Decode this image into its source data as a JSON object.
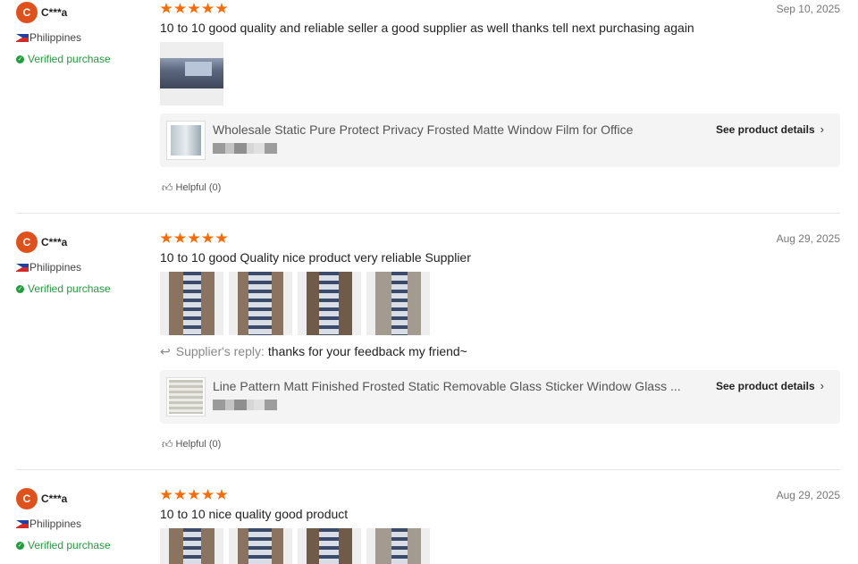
{
  "colors": {
    "accent_star": "#ff6a00",
    "avatar_bg": "#e0501b",
    "verified_green": "#1f9d3a"
  },
  "reviews": [
    {
      "avatar_initial": "C",
      "username": "C***a",
      "country": "Philippines",
      "flag_icon": "philippines-flag-icon",
      "verified": "Verified purchase",
      "rating": 5,
      "date": "Sep 10, 2025",
      "text": "10 to 10 good quality and reliable seller a good supplier as well thanks tell next purchasing again",
      "product_title": "Wholesale Static Pure Protect Privacy Frosted Matte Window Film for Office",
      "see_details": "See product details",
      "helpful": "Helpful (0)"
    },
    {
      "avatar_initial": "C",
      "username": "C***a",
      "country": "Philippines",
      "flag_icon": "philippines-flag-icon",
      "verified": "Verified purchase",
      "rating": 5,
      "date": "Aug 29, 2025",
      "text": "10 to 10 good Quality nice product very reliable Supplier",
      "reply_label": "Supplier's reply:",
      "reply_text": "thanks for your feedback my friend~",
      "product_title": "Line Pattern Matt Finished Frosted Static Removable Glass Sticker Window Glass ...",
      "see_details": "See product details",
      "helpful": "Helpful (0)"
    },
    {
      "avatar_initial": "C",
      "username": "C***a",
      "country": "Philippines",
      "flag_icon": "philippines-flag-icon",
      "verified": "Verified purchase",
      "rating": 5,
      "date": "Aug 29, 2025",
      "text": "10 to 10 nice quality good product"
    }
  ]
}
